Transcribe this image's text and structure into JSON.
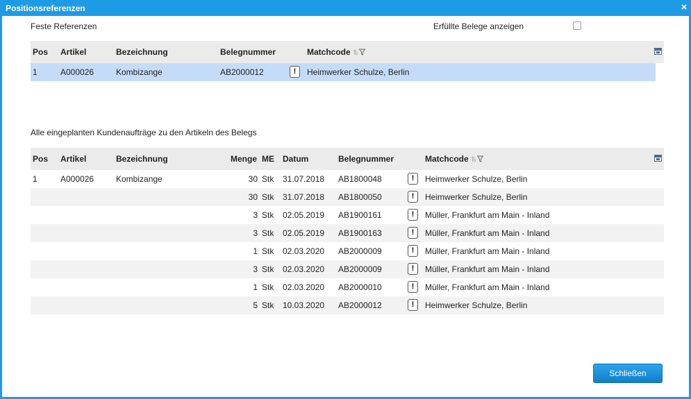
{
  "dialog": {
    "title": "Positionsreferenzen",
    "close_glyph": "×"
  },
  "fixed": {
    "section_label": "Feste Referenzen",
    "show_fulfilled_label": "Erfüllte Belege anzeigen",
    "show_fulfilled_checked": false,
    "headers": {
      "pos": "Pos",
      "artikel": "Artikel",
      "bezeichnung": "Bezeichnung",
      "belegnummer": "Belegnummer",
      "matchcode": "Matchcode"
    },
    "rows": [
      {
        "pos": "1",
        "artikel": "A000026",
        "bezeichnung": "Kombizange",
        "belegnummer": "AB2000012",
        "info": "!",
        "matchcode": "Heimwerker Schulze, Berlin"
      }
    ]
  },
  "planned": {
    "section_label": "Alle eingeplanten Kundenaufträge zu den Artikeln des Belegs",
    "headers": {
      "pos": "Pos",
      "artikel": "Artikel",
      "bezeichnung": "Bezeichnung",
      "menge": "Menge",
      "me": "ME",
      "datum": "Datum",
      "belegnummer": "Belegnummer",
      "matchcode": "Matchcode"
    },
    "rows": [
      {
        "pos": "1",
        "artikel": "A000026",
        "bezeichnung": "Kombizange",
        "menge": "30",
        "me": "Stk",
        "datum": "31.07.2018",
        "belegnummer": "AB1800048",
        "info": "!",
        "matchcode": "Heimwerker Schulze, Berlin"
      },
      {
        "pos": "",
        "artikel": "",
        "bezeichnung": "",
        "menge": "30",
        "me": "Stk",
        "datum": "31.07.2018",
        "belegnummer": "AB1800050",
        "info": "!",
        "matchcode": "Heimwerker Schulze, Berlin"
      },
      {
        "pos": "",
        "artikel": "",
        "bezeichnung": "",
        "menge": "3",
        "me": "Stk",
        "datum": "02.05.2019",
        "belegnummer": "AB1900161",
        "info": "!",
        "matchcode": "Müller, Frankfurt am Main - Inland"
      },
      {
        "pos": "",
        "artikel": "",
        "bezeichnung": "",
        "menge": "3",
        "me": "Stk",
        "datum": "02.05.2019",
        "belegnummer": "AB1900163",
        "info": "!",
        "matchcode": "Müller, Frankfurt am Main - Inland"
      },
      {
        "pos": "",
        "artikel": "",
        "bezeichnung": "",
        "menge": "1",
        "me": "Stk",
        "datum": "02.03.2020",
        "belegnummer": "AB2000009",
        "info": "!",
        "matchcode": "Müller, Frankfurt am Main - Inland"
      },
      {
        "pos": "",
        "artikel": "",
        "bezeichnung": "",
        "menge": "3",
        "me": "Stk",
        "datum": "02.03.2020",
        "belegnummer": "AB2000009",
        "info": "!",
        "matchcode": "Müller, Frankfurt am Main - Inland"
      },
      {
        "pos": "",
        "artikel": "",
        "bezeichnung": "",
        "menge": "1",
        "me": "Stk",
        "datum": "02.03.2020",
        "belegnummer": "AB2000010",
        "info": "!",
        "matchcode": "Müller, Frankfurt am Main - Inland"
      },
      {
        "pos": "",
        "artikel": "",
        "bezeichnung": "",
        "menge": "5",
        "me": "Stk",
        "datum": "10.03.2020",
        "belegnummer": "AB2000012",
        "info": "!",
        "matchcode": "Heimwerker Schulze, Berlin"
      }
    ]
  },
  "footer": {
    "close_label": "Schließen"
  },
  "colors": {
    "accent": "#1e9be6",
    "selected_row": "#c4dcf8",
    "header_bg": "#ebebeb"
  },
  "icons": {
    "close": "close-icon",
    "sort": "sort-icon",
    "filter": "filter-icon",
    "column_chooser": "column-chooser-icon",
    "info": "info-icon"
  }
}
